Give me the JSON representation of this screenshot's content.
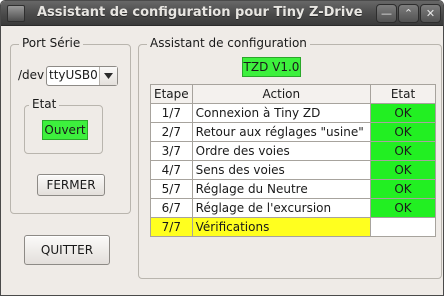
{
  "window": {
    "title": "Assistant de configuration pour Tiny Z-Drive",
    "controls": {
      "minimize": "—",
      "maximize": "⌃",
      "close": "✕"
    }
  },
  "port": {
    "group_title": "Port Série",
    "device_prefix": "/dev",
    "device_value": "ttyUSB0",
    "state_group_title": "Etat",
    "state_value": "Ouvert",
    "close_label": "FERMER"
  },
  "quit_label": "QUITTER",
  "wizard": {
    "group_title": "Assistant de configuration",
    "version": "TZD V1.0",
    "columns": [
      "Etape",
      "Action",
      "Etat"
    ],
    "rows": [
      {
        "step": "1/7",
        "action": "Connexion à Tiny ZD",
        "state": "OK"
      },
      {
        "step": "2/7",
        "action": "Retour aux réglages \"usine\"",
        "state": "OK"
      },
      {
        "step": "3/7",
        "action": "Ordre des voies",
        "state": "OK"
      },
      {
        "step": "4/7",
        "action": "Sens des voies",
        "state": "OK"
      },
      {
        "step": "5/7",
        "action": "Réglage du Neutre",
        "state": "OK"
      },
      {
        "step": "6/7",
        "action": "Réglage de l'excursion",
        "state": "OK"
      },
      {
        "step": "7/7",
        "action": "Vérifications",
        "state": ""
      }
    ]
  },
  "colors": {
    "ok_green": "#22ef22",
    "current_yellow": "#ffff1f",
    "titlebar_dark": "#4a4a4a"
  }
}
